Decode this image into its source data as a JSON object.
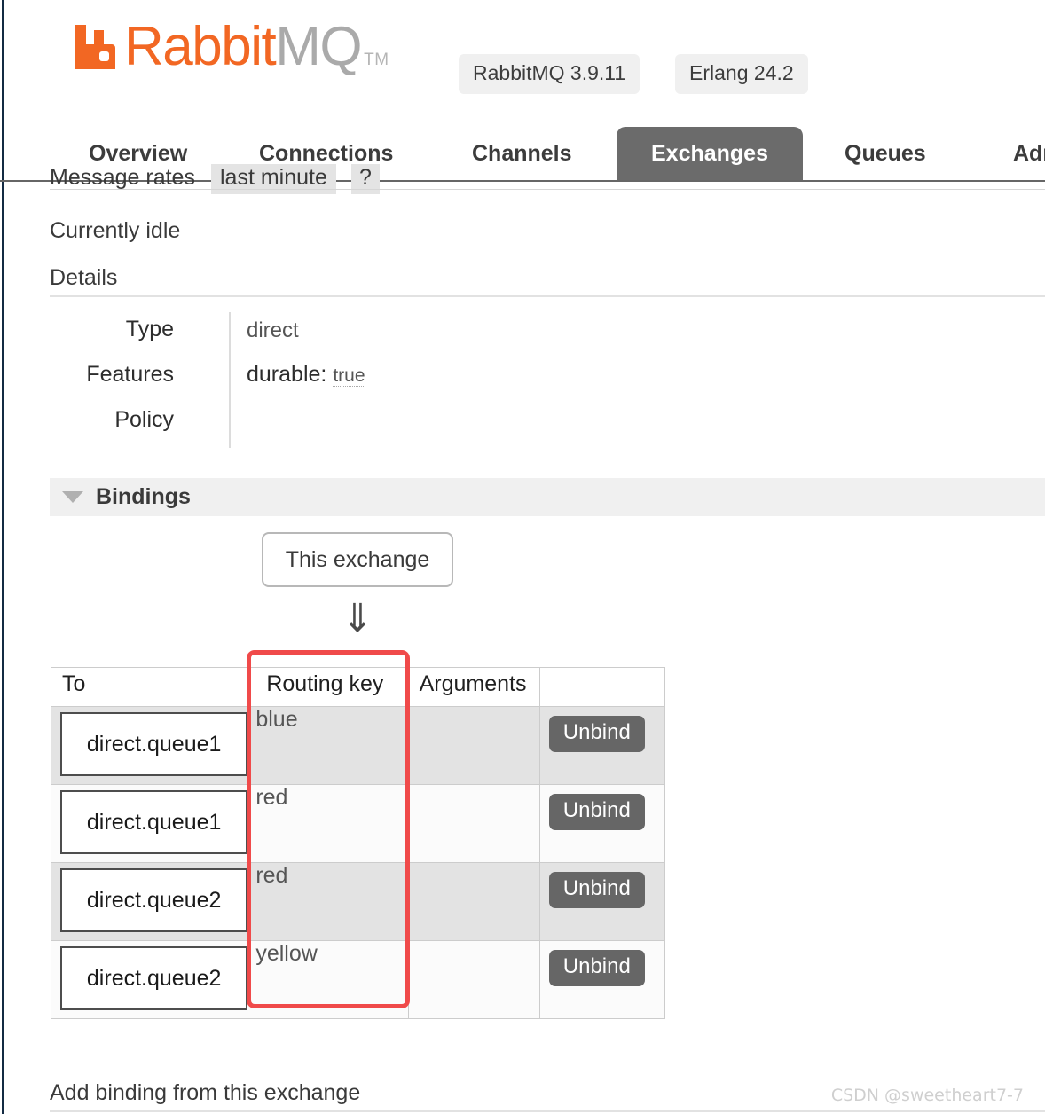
{
  "window": {
    "edge_color": "#132b43"
  },
  "header": {
    "logo_primary": "Rabbit",
    "logo_secondary": "MQ",
    "trademark": "TM",
    "logo_color": "#f26723",
    "badges": [
      {
        "label": "RabbitMQ 3.9.11"
      },
      {
        "label": "Erlang 24.2"
      }
    ]
  },
  "nav": {
    "tabs": [
      {
        "label": "Overview",
        "active": false
      },
      {
        "label": "Connections",
        "active": false
      },
      {
        "label": "Channels",
        "active": false
      },
      {
        "label": "Exchanges",
        "active": true
      },
      {
        "label": "Queues",
        "active": false
      },
      {
        "label": "Adm",
        "active": false
      }
    ],
    "active_color": "#6b6b6b"
  },
  "rates": {
    "label": "Message rates",
    "period": "last minute",
    "help": "?"
  },
  "status": {
    "idle_text": "Currently idle"
  },
  "details": {
    "heading": "Details",
    "rows": [
      {
        "label": "Type",
        "value": "direct"
      },
      {
        "label": "Features",
        "value": "durable:",
        "extra": "true"
      },
      {
        "label": "Policy",
        "value": ""
      }
    ]
  },
  "bindings": {
    "section_title": "Bindings",
    "exchange_node_label": "This exchange",
    "arrow_glyph": "⇓",
    "columns": [
      "To",
      "Routing key",
      "Arguments",
      ""
    ],
    "rows": [
      {
        "to": "direct.queue1",
        "routing_key": "blue",
        "arguments": "",
        "action": "Unbind"
      },
      {
        "to": "direct.queue1",
        "routing_key": "red",
        "arguments": "",
        "action": "Unbind"
      },
      {
        "to": "direct.queue2",
        "routing_key": "red",
        "arguments": "",
        "action": "Unbind"
      },
      {
        "to": "direct.queue2",
        "routing_key": "yellow",
        "arguments": "",
        "action": "Unbind"
      }
    ],
    "highlight_color": "#f04a4a"
  },
  "footer": {
    "add_binding_heading": "Add binding from this exchange",
    "watermark": "CSDN @sweetheart7-7"
  }
}
